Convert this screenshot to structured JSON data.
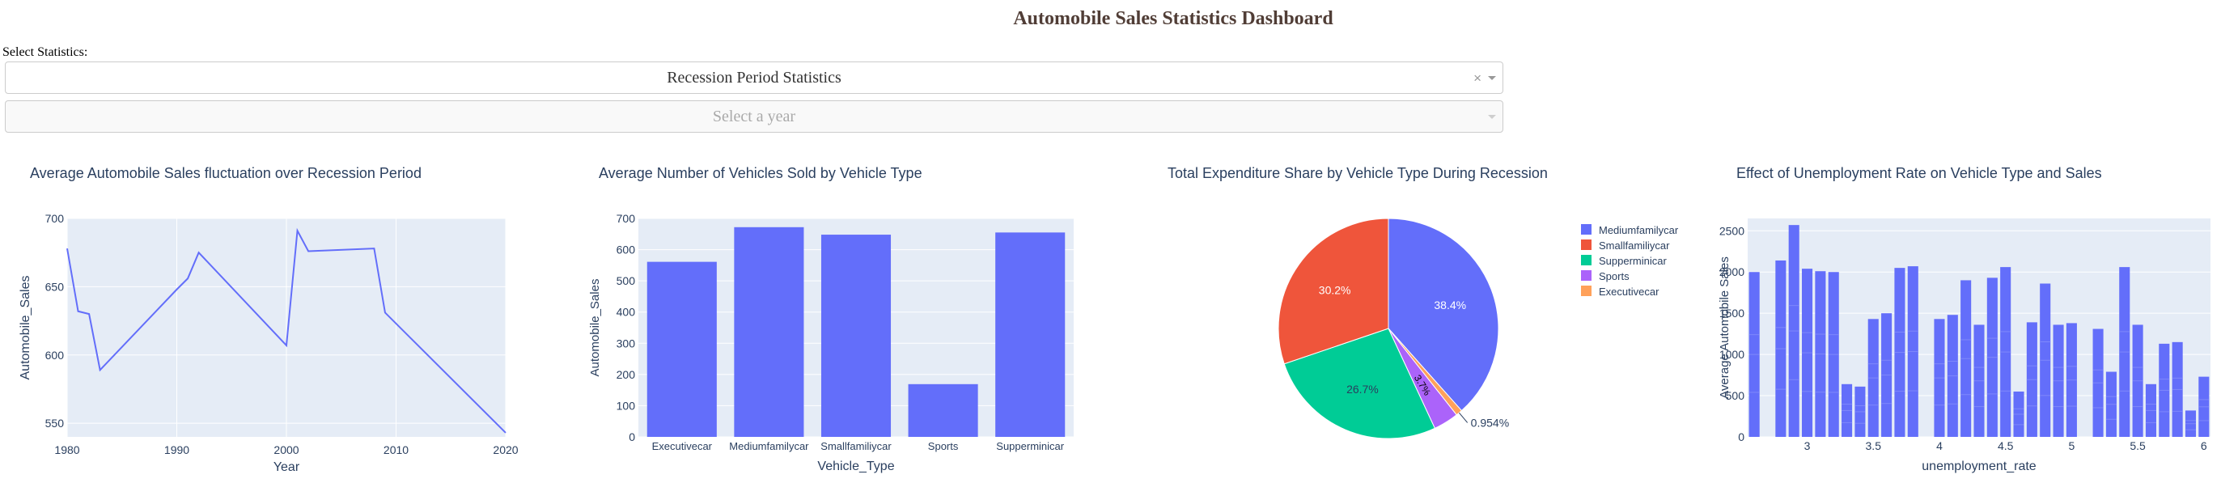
{
  "dashboard": {
    "title": "Automobile Sales Statistics Dashboard",
    "select_label": "Select Statistics:",
    "statistics_dropdown": {
      "value": "Recession Period Statistics"
    },
    "year_dropdown": {
      "placeholder": "Select a year"
    }
  },
  "colors": {
    "plot_bg": "#E5ECF6",
    "grid": "#ffffff",
    "text": "#2a3f5f",
    "primary": "#636EFA",
    "title": "#503d36"
  },
  "chart_data": [
    {
      "type": "line",
      "title": "Average Automobile Sales fluctuation over Recession Period",
      "xlabel": "Year",
      "ylabel": "Automobile_Sales",
      "xlim": [
        1980,
        2020
      ],
      "ylim": [
        540,
        700
      ],
      "xticks": [
        1980,
        1990,
        2000,
        2010,
        2020
      ],
      "yticks": [
        550,
        600,
        650,
        700
      ],
      "x": [
        1980,
        1981,
        1982,
        1983,
        1990,
        1991,
        1992,
        2000,
        2001,
        2002,
        2008,
        2009,
        2020
      ],
      "y": [
        678,
        632,
        630,
        589,
        648,
        656,
        675,
        607,
        691,
        676,
        678,
        631,
        543
      ]
    },
    {
      "type": "bar",
      "title": "Average Number of Vehicles Sold by Vehicle Type",
      "xlabel": "Vehicle_Type",
      "ylabel": "Automobile_Sales",
      "ylim": [
        0,
        700
      ],
      "yticks": [
        0,
        100,
        200,
        300,
        400,
        500,
        600,
        700
      ],
      "categories": [
        "Executivecar",
        "Mediumfamilycar",
        "Smallfamiliycar",
        "Sports",
        "Supperminicar"
      ],
      "values": [
        561,
        672,
        648,
        169,
        655
      ]
    },
    {
      "type": "pie",
      "title": "Total Expenditure Share by Vehicle Type During Recession",
      "legend_position": "right",
      "slices": [
        {
          "label": "Mediumfamilycar",
          "percent": 38.4,
          "text": "38.4%",
          "color": "#636EFA"
        },
        {
          "label": "Smallfamiliycar",
          "percent": 30.2,
          "text": "30.2%",
          "color": "#EF553B"
        },
        {
          "label": "Supperminicar",
          "percent": 26.7,
          "text": "26.7%",
          "color": "#00CC96"
        },
        {
          "label": "Sports",
          "percent": 3.7,
          "text": "3.7%",
          "color": "#AB63FA"
        },
        {
          "label": "Executivecar",
          "percent": 0.954,
          "text": "0.954%",
          "color": "#FFA15A"
        }
      ],
      "draw_order": [
        0,
        4,
        3,
        2,
        1
      ]
    },
    {
      "type": "bar",
      "title": "Effect of Unemployment Rate on Vehicle Type and Sales",
      "xlabel": "unemployment_rate",
      "ylabel": "Average Automobile Sales",
      "xlim": [
        2.55,
        6.05
      ],
      "ylim": [
        0,
        2650
      ],
      "xticks": [
        3,
        3.5,
        4,
        4.5,
        5,
        5.5,
        6
      ],
      "xticklabels": [
        "3",
        "3.5",
        "4",
        "4.5",
        "5",
        "5.5",
        "6"
      ],
      "yticks": [
        0,
        500,
        1000,
        1500,
        2000,
        2500
      ],
      "x": [
        2.6,
        2.8,
        2.9,
        3.0,
        3.1,
        3.2,
        3.3,
        3.4,
        3.5,
        3.6,
        3.7,
        3.8,
        4.0,
        4.1,
        4.2,
        4.3,
        4.4,
        4.5,
        4.6,
        4.7,
        4.8,
        4.9,
        5.0,
        5.2,
        5.3,
        5.4,
        5.5,
        5.6,
        5.7,
        5.8,
        5.9,
        6.0
      ],
      "values": [
        2000,
        2140,
        2570,
        2040,
        2010,
        2000,
        640,
        610,
        1430,
        1500,
        2050,
        2070,
        1430,
        1480,
        1900,
        1360,
        1930,
        2060,
        550,
        1390,
        1860,
        1360,
        1380,
        1310,
        790,
        2060,
        1360,
        640,
        1130,
        1150,
        320,
        730
      ]
    }
  ]
}
